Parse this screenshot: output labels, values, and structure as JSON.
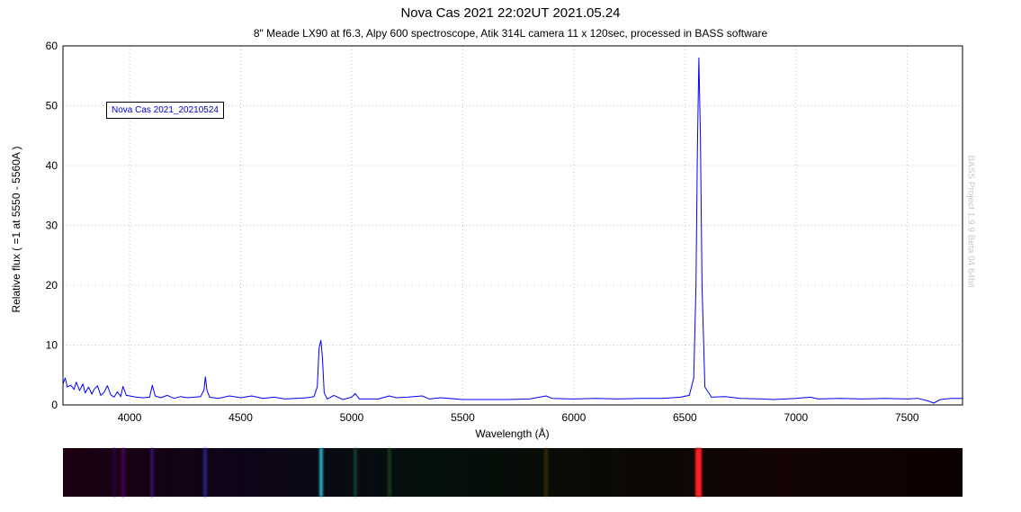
{
  "chart_data": {
    "type": "line",
    "title": "Nova Cas 2021 22:02UT 2021.05.24",
    "subtitle": "8\" Meade LX90 at f6.3, Alpy 600 spectroscope, Atik 314L camera 11 x 120sec, processed in BASS software",
    "xlabel": "Wavelength (Å)",
    "ylabel": "Relative flux ( =1 at 5550 - 5560A )",
    "xlim": [
      3700,
      7750
    ],
    "ylim": [
      0,
      60
    ],
    "x_ticks": [
      4000,
      4500,
      5000,
      5500,
      6000,
      6500,
      7000,
      7500
    ],
    "y_ticks": [
      0,
      10,
      20,
      30,
      40,
      50,
      60
    ],
    "grid": true,
    "legend_position": "top-left",
    "series": [
      {
        "name": "Nova Cas 2021_20210524",
        "color": "#0000ff",
        "x": [
          3700,
          3710,
          3720,
          3735,
          3750,
          3760,
          3775,
          3790,
          3800,
          3815,
          3830,
          3840,
          3855,
          3870,
          3885,
          3900,
          3915,
          3930,
          3945,
          3960,
          3970,
          3985,
          4000,
          4030,
          4060,
          4090,
          4102,
          4115,
          4140,
          4170,
          4200,
          4230,
          4260,
          4290,
          4320,
          4335,
          4341,
          4348,
          4360,
          4400,
          4450,
          4500,
          4550,
          4600,
          4650,
          4700,
          4750,
          4800,
          4830,
          4845,
          4853,
          4861,
          4868,
          4876,
          4890,
          4920,
          4960,
          5000,
          5016,
          5035,
          5080,
          5120,
          5169,
          5200,
          5250,
          5317,
          5350,
          5400,
          5500,
          5600,
          5700,
          5800,
          5876,
          5900,
          6000,
          6100,
          6200,
          6300,
          6400,
          6480,
          6520,
          6540,
          6550,
          6556,
          6563,
          6570,
          6577,
          6590,
          6620,
          6680,
          6750,
          6850,
          6900,
          7000,
          7065,
          7100,
          7200,
          7300,
          7400,
          7500,
          7550,
          7600,
          7620,
          7650,
          7700,
          7750
        ],
        "y": [
          3.5,
          4.5,
          3.0,
          3.3,
          2.6,
          3.8,
          2.4,
          3.5,
          2.0,
          3.0,
          1.8,
          2.6,
          3.2,
          1.6,
          2.1,
          3.2,
          1.7,
          1.3,
          2.2,
          1.4,
          3.1,
          1.6,
          1.5,
          1.3,
          1.2,
          1.3,
          3.3,
          1.5,
          1.2,
          1.6,
          1.1,
          1.4,
          1.2,
          1.3,
          1.4,
          2.5,
          4.7,
          2.5,
          1.3,
          1.1,
          1.5,
          1.2,
          1.5,
          1.1,
          1.3,
          1.0,
          1.1,
          1.2,
          1.4,
          3.0,
          9.5,
          10.8,
          8.0,
          2.0,
          1.0,
          1.6,
          0.9,
          1.3,
          1.9,
          1.0,
          1.0,
          1.0,
          1.5,
          1.2,
          1.3,
          1.5,
          1.0,
          1.2,
          0.9,
          0.9,
          0.9,
          1.0,
          1.5,
          1.1,
          1.0,
          1.1,
          1.0,
          1.1,
          1.1,
          1.3,
          1.6,
          4.5,
          20.0,
          42.0,
          58.0,
          45.0,
          20.0,
          3.0,
          1.3,
          1.4,
          1.1,
          1.0,
          0.9,
          1.1,
          1.3,
          1.0,
          1.1,
          1.0,
          1.1,
          1.0,
          1.1,
          0.6,
          0.3,
          0.9,
          1.1,
          1.1
        ]
      }
    ]
  },
  "legend_text": "Nova Cas 2021_20210524",
  "watermark": "BASS Project 1.9.9 Beta 04 64bit",
  "colors": {
    "line": "#0000ff",
    "grid": "#c0c0c0",
    "frame": "#000000"
  },
  "strip_lines": [
    {
      "x": 3930,
      "color": "#3a0050",
      "alpha": 0.6
    },
    {
      "x": 3970,
      "color": "#5a0070",
      "alpha": 0.7
    },
    {
      "x": 4102,
      "color": "#3a1a80",
      "alpha": 0.7
    },
    {
      "x": 4341,
      "color": "#2a2aa0",
      "alpha": 0.8
    },
    {
      "x": 4861,
      "color": "#2aa8b8",
      "alpha": 1.0
    },
    {
      "x": 5016,
      "color": "#1a5a40",
      "alpha": 0.6
    },
    {
      "x": 5169,
      "color": "#306020",
      "alpha": 0.5
    },
    {
      "x": 5876,
      "color": "#604000",
      "alpha": 0.5
    },
    {
      "x": 6563,
      "color": "#ff2020",
      "alpha": 1.0
    }
  ]
}
